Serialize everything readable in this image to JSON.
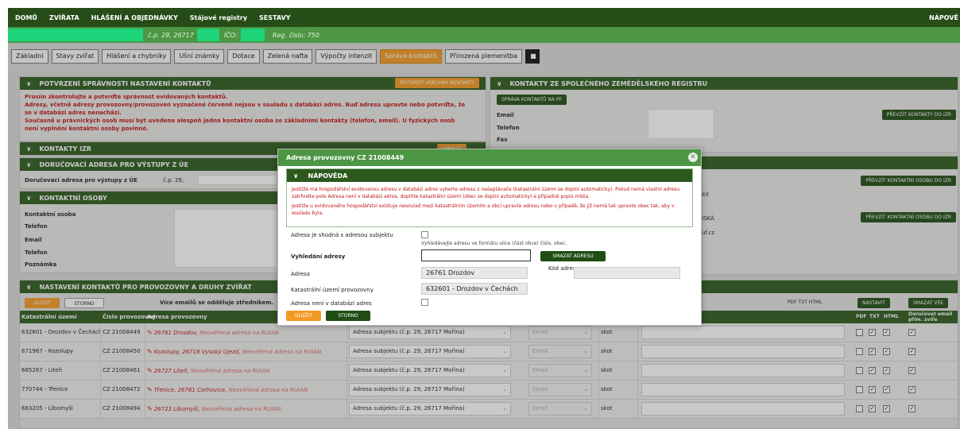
{
  "topbar": {
    "items": [
      "DOMŮ",
      "ZVÍŘATA",
      "HLÁŠENÍ A OBJEDNÁVKY",
      "Stájové registry",
      "SESTAVY"
    ],
    "help": "NÁPOVĚ"
  },
  "subbar": {
    "cp": "č.p. 29, 26717",
    "ico": "IČO:",
    "reg": "Reg. číslo: 750"
  },
  "tabs": [
    "Základní",
    "Stavy zvířat",
    "Hlášení a chybníky",
    "Ušní známky",
    "Dotace",
    "Zelená nafta",
    "Výpočty intenzit",
    "Správa kontaktů",
    "Přirozená plemenitba"
  ],
  "panel_confirm": {
    "title": "POTVRZENÍ SPRÁVNOSTI NASTAVENÍ KONTAKTŮ",
    "button": "POTVRDIT VŠECHNY KONTAKTY",
    "lines": [
      "Prosím zkontrolujte a potvrďte správnost evidovaných kontaktů.",
      "Adresy, včetně adresy provozovny/provozoven vyznačené červeně nejsou v souladu s databází adres. Buď adresu upravte nebo potvrďte, že se v databázi adres nenachází.",
      "Současně u právnických osob musí být uvedena alespoň jedna kontaktní osoba se základními kontakty (telefon, email). U fyzických osob není vyplnění kontaktní osoby povinné."
    ]
  },
  "panel_izr": {
    "title": "KONTAKTY IZR",
    "button": "UPRAVIT"
  },
  "panel_doruc": {
    "title": "DORUČOVACÍ ADRESA PRO VÝSTUPY Z ÚE",
    "label": "Doručovací adresa pro výstupy z ÚE",
    "value": "č.p. 29,"
  },
  "panel_kontakt": {
    "title": "KONTAKTNÍ OSOBY",
    "labels": [
      "Kontaktní osoba",
      "Telefon",
      "Email",
      "Telefon",
      "Poznámka"
    ]
  },
  "panel_szr": {
    "title": "KONTAKTY ZE SPOLEČNÉHO ZEMĚDĚLSKÉHO REGISTRU",
    "button": "SPRÁVA KONTAKTŮ NA PF",
    "labels": [
      "Email",
      "Telefon",
      "Fax"
    ],
    "btn1": "PŘEVZÍT KONTAKTY DO IZR",
    "btn2": "PŘEVZÍT KONTAKTNÍ OSOBU DO IZR",
    "btn3": "PŘEVZÍT KONTAKTNÍ OSOBU DO IZR",
    "frag1": "ěX",
    "frag2": "ISKÁ",
    "frag3": "uf.cz"
  },
  "panel_prov": {
    "title": "NASTAVENÍ KONTAKTŮ PRO PROVOZOVNY A DRUHY ZVÍŘAT",
    "save": "ULOŽIT",
    "cancel": "STORNO",
    "note": "Více emailů se odděluje středníkem.",
    "exports": "PDF TXT HTML",
    "set": "NASTAVIT",
    "clear": "SMAZAT VŠE"
  },
  "table": {
    "headers": {
      "ku": "Katastrální území",
      "cp": "Číslo provozovny",
      "ap": "Adresa provozovny",
      "pdf": "PDF",
      "txt": "TXT",
      "html": "HTML",
      "dor": "Doručovat email přím. zvíře"
    },
    "rows": [
      {
        "ku": "632601 - Drozdov v Čechách",
        "cp": "CZ 21008449",
        "addr": "26761 Drozdov,",
        "note": "Neověřená adresa na RUIAN",
        "sel": "Adresa subjektu (č.p. 29, 26717 Mořina)",
        "typ": "Email",
        "druh": "skot"
      },
      {
        "ku": "671967 - Kozolupy",
        "cp": "CZ 21008450",
        "addr": "Kozolupy, 26718 Vysoký Újezd,",
        "note": "Neověřená adresa na RUIAN",
        "sel": "Adresa subjektu (č.p. 29, 26717 Mořina)",
        "typ": "Email",
        "druh": "skot"
      },
      {
        "ku": "685267 - Liteň",
        "cp": "CZ 21008461",
        "addr": "26727 Liteň,",
        "note": "Neověřená adresa na RUIAN",
        "sel": "Adresa subjektu (č.p. 29, 26717 Mořina)",
        "typ": "Email",
        "druh": "skot"
      },
      {
        "ku": "770744 - Třenice",
        "cp": "CZ 21008472",
        "addr": "Třenice, 26761 Cerhovice,",
        "note": "Neověřená adresa na RUIAN",
        "sel": "Adresa subjektu (č.p. 29, 26717 Mořina)",
        "typ": "Email",
        "druh": "skot"
      },
      {
        "ku": "683205 - Libomyšl",
        "cp": "CZ 21008494",
        "addr": "26723 Libomyšl,",
        "note": "Neověřená adresa na RUIAN",
        "sel": "Adresa subjektu (č.p. 29, 26717 Mořina)",
        "typ": "Email",
        "druh": "skot"
      }
    ]
  },
  "modal": {
    "title": "Adresa provozovny CZ 21008449",
    "help_title": "NÁPOVĚDA",
    "help1": "Jestliže má hospodářství evidovanou adresu v databázi adres vyberte adresu z našeptávače (katastrální území se doplní automaticky). Pokud nemá vlastní adresu zatrhněte pole Adresa není v databázi adres, doplňte katastrální území (obec se doplní automaticky) a případně popis místa.",
    "help2": "Jestliže u evidovaného hospodářství existuje nesoulad mezi katastrálním územím a obcí upravte adresu nebo v případě, že již nemá tak upravte obec tak, aby v souladu byla.",
    "same_label": "Adresa je shodná s adresou subjektu",
    "hint": "Vyhledávejte adresu ve formátu ulice (část obce) číslo, obec.",
    "search_label": "Vyhledání adresy",
    "delete_btn": "SMAZAT ADRESU",
    "addr_label": "Adresa",
    "addr_value": "26761 Drozdov",
    "code_label": "Kód adresy",
    "ku_label": "Katastrální území provozovny",
    "ku_value": "632601 - Drozdov v Čechách",
    "notdb_label": "Adresa není v databázi adres",
    "save": "ULOŽIT",
    "cancel": "STORNO"
  }
}
